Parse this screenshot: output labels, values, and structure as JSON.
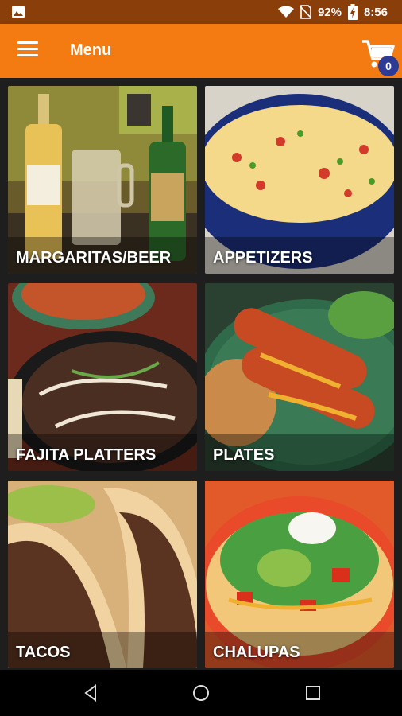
{
  "status_bar": {
    "battery_percent": "92%",
    "time": "8:56",
    "icons": [
      "image-icon",
      "wifi-icon",
      "no-sim-icon",
      "battery-charging-icon"
    ]
  },
  "app_bar": {
    "title": "Menu",
    "cart_count": "0",
    "accent_color": "#f47a12",
    "badge_color": "#2d3a96"
  },
  "menu": {
    "categories": [
      {
        "label": "MARGARITAS/BEER"
      },
      {
        "label": "APPETIZERS"
      },
      {
        "label": "FAJITA PLATTERS"
      },
      {
        "label": "PLATES"
      },
      {
        "label": "TACOS"
      },
      {
        "label": "CHALUPAS"
      }
    ]
  },
  "nav_bar": {
    "buttons": [
      "back-icon",
      "home-icon",
      "recents-icon"
    ]
  }
}
